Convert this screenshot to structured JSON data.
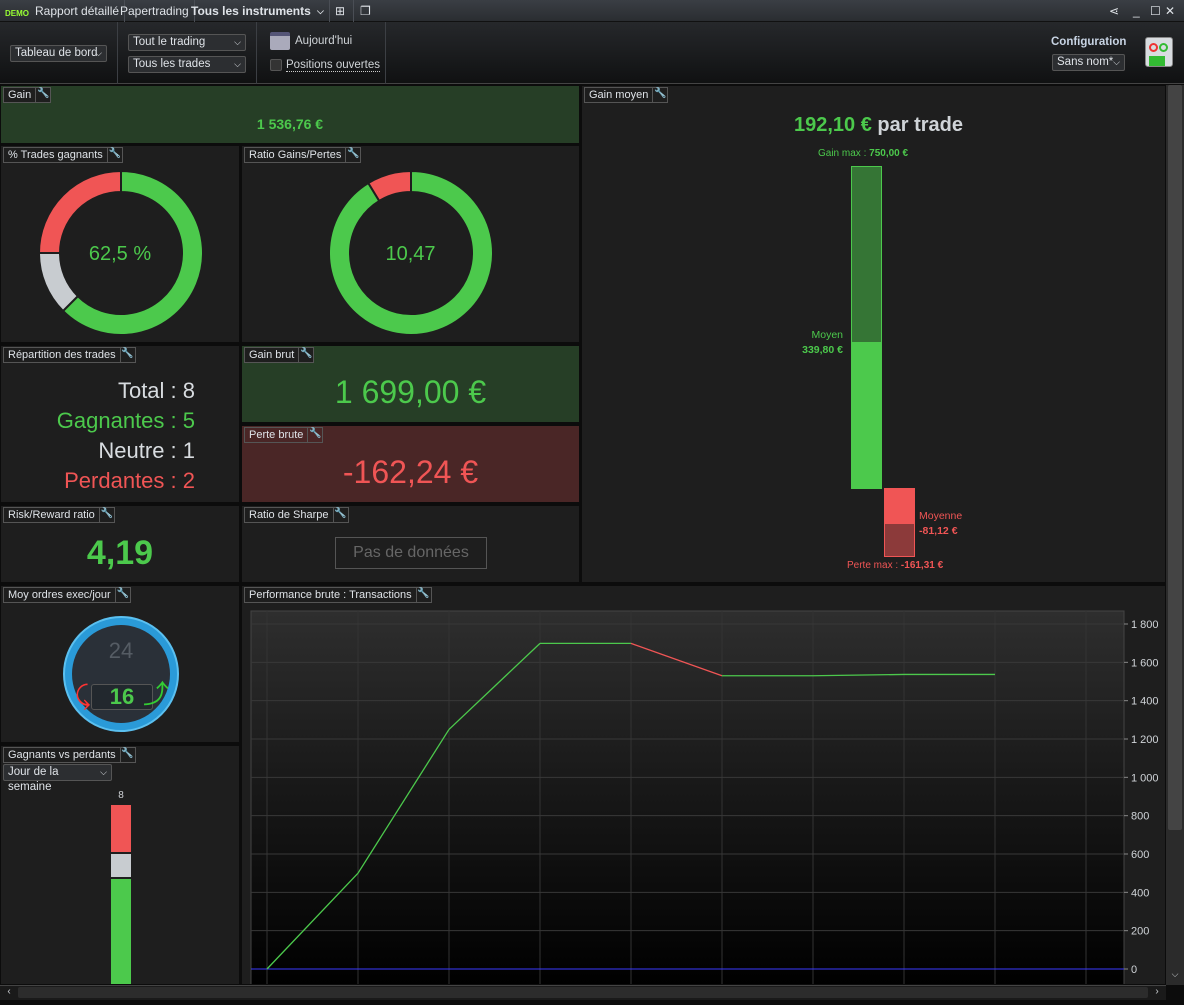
{
  "titlebar": {
    "logo": "DEMO",
    "tabs": [
      "Rapport détaillé",
      "Papertrading",
      "Tous les instruments"
    ],
    "icons": [
      "add-chart-icon",
      "copy-document-icon",
      "share-icon",
      "minimize-icon",
      "maximize-icon",
      "close-icon"
    ]
  },
  "toolbar": {
    "view_select": "Tableau de bord",
    "trading_select": "Tout le trading",
    "trades_select": "Tous les trades",
    "date_label": "Aujourd'hui",
    "open_positions_label": "Positions ouvertes",
    "open_positions_checked": false,
    "config_label": "Configuration",
    "config_select": "Sans nom*"
  },
  "colors": {
    "green": "#4cc94c",
    "red": "#f05555",
    "gray": "#c8ccd0",
    "bg": "#1e1e1e"
  },
  "panels": {
    "gain": {
      "title": "Gain",
      "value": "1 536,76 €"
    },
    "win_pct": {
      "title": "% Trades gagnants",
      "value": "62,5 %",
      "segments": {
        "win": 62.5,
        "neutral": 12.5,
        "loss": 25
      }
    },
    "ratio": {
      "title": "Ratio Gains/Pertes",
      "value": "10,47",
      "segments": {
        "gain": 1699.0,
        "loss": 162.24
      }
    },
    "repartition": {
      "title": "Répartition des trades",
      "total": "Total : 8",
      "winners": "Gagnantes : 5",
      "neutral": "Neutre : 1",
      "losers": "Perdantes : 2"
    },
    "gross_gain": {
      "title": "Gain brut",
      "value": "1 699,00 €"
    },
    "gross_loss": {
      "title": "Perte brute",
      "value": "-162,24 €"
    },
    "risk_reward": {
      "title": "Risk/Reward ratio",
      "value": "4,19"
    },
    "sharpe": {
      "title": "Ratio de Sharpe",
      "value": "Pas de données"
    },
    "avg_gain": {
      "title": "Gain moyen",
      "value": "192,10 €",
      "suffix": "par trade",
      "gain_max_label": "Gain max :",
      "gain_max": "750,00 €",
      "avg_win_label": "Moyen",
      "avg_win": "339,80 €",
      "avg_loss_label": "Moyenne",
      "avg_loss": "-81,12 €",
      "loss_max_label": "Perte max :",
      "loss_max": "-161,31 €",
      "gain_max_value": 750,
      "avg_win_value": 339.8,
      "avg_loss_value": -81.12,
      "loss_max_value": -161.31
    },
    "orders": {
      "title": "Moy ordres exec/jour",
      "clock_label": "24",
      "value": "16"
    },
    "win_vs_loss": {
      "title": "Gagnants vs perdants",
      "select": "Jour de la semaine",
      "bar_total": "8",
      "counts": {
        "win": 5,
        "neutral": 1,
        "loss": 2
      }
    },
    "performance": {
      "title": "Performance brute : Transactions"
    }
  },
  "chart_data": {
    "type": "line",
    "title": "Performance brute : Transactions",
    "x": [
      0,
      1,
      2,
      3,
      4,
      5,
      6,
      7,
      8
    ],
    "values": [
      0,
      500,
      1250,
      1699,
      1699,
      1530,
      1530,
      1536.76,
      1536.76
    ],
    "ylim": [
      0,
      1850
    ],
    "yticks": [
      "0",
      "200",
      "400",
      "600",
      "800",
      "1 000",
      "1 200",
      "1 400",
      "1 600",
      "1 800"
    ],
    "ytick_values": [
      0,
      200,
      400,
      600,
      800,
      1000,
      1200,
      1400,
      1600,
      1800
    ],
    "grid": true,
    "up_color": "#4cc94c",
    "down_color": "#f05555",
    "zero_line_color": "#3a3aff"
  }
}
